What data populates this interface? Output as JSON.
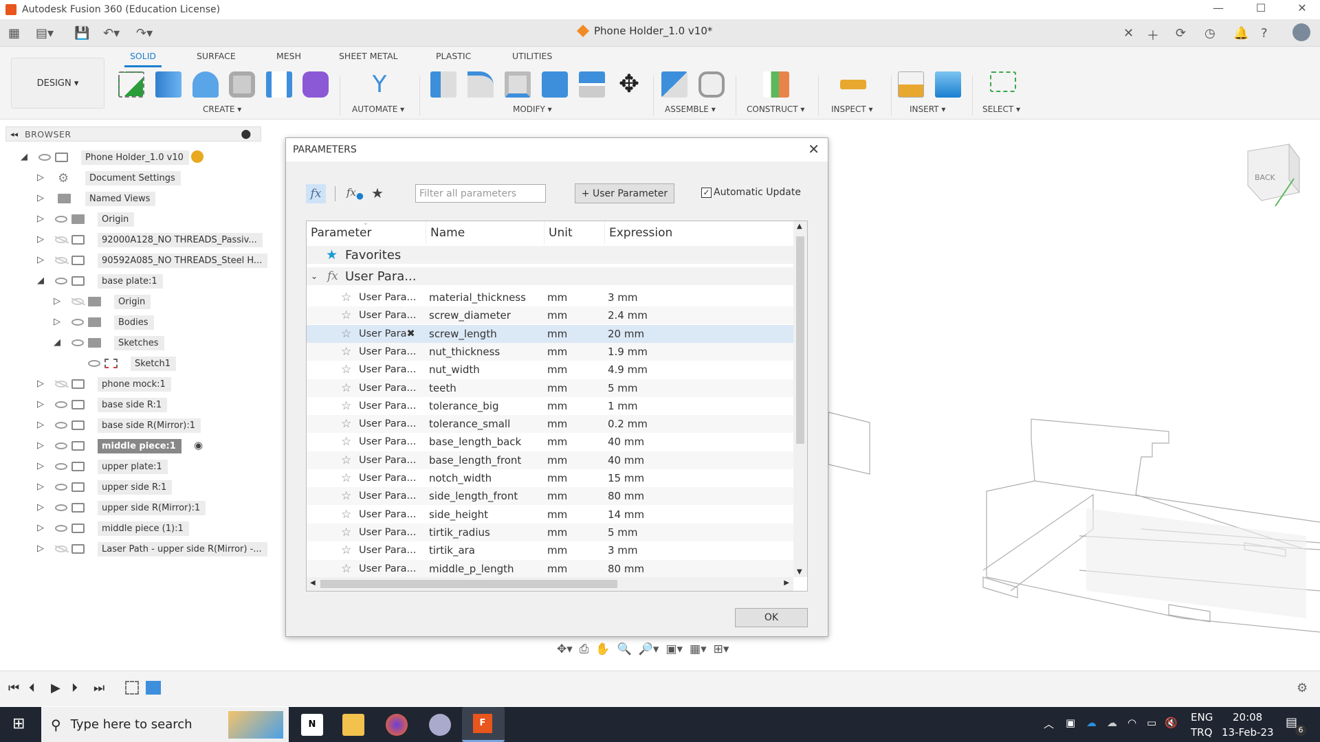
{
  "window": {
    "title": "Autodesk Fusion 360 (Education License)",
    "minimize": "—",
    "maximize": "☐",
    "close": "✕"
  },
  "document_tab": {
    "title": "Phone Holder_1.0 v10*",
    "close": "✕"
  },
  "ribbon": {
    "workspace": "DESIGN ▾",
    "tabs": [
      "SOLID",
      "SURFACE",
      "MESH",
      "SHEET METAL",
      "PLASTIC",
      "UTILITIES"
    ],
    "active_tab": "SOLID",
    "groups": [
      "CREATE ▾",
      "AUTOMATE ▾",
      "MODIFY ▾",
      "ASSEMBLE ▾",
      "CONSTRUCT ▾",
      "INSPECT ▾",
      "INSERT ▾",
      "SELECT ▾"
    ]
  },
  "browser": {
    "title": "BROWSER",
    "items": [
      {
        "label": "Phone Holder_1.0 v10",
        "level": 0,
        "expanded": true,
        "icon": "document",
        "visible": true
      },
      {
        "label": "Document Settings",
        "level": 1,
        "icon": "gear"
      },
      {
        "label": "Named Views",
        "level": 1,
        "icon": "folder"
      },
      {
        "label": "Origin",
        "level": 1,
        "icon": "folder",
        "visible": true
      },
      {
        "label": "92000A128_NO THREADS_Passiv...",
        "level": 1,
        "icon": "component",
        "visible": false
      },
      {
        "label": "90592A085_NO THREADS_Steel H...",
        "level": 1,
        "icon": "component",
        "visible": false
      },
      {
        "label": "base plate:1",
        "level": 1,
        "expanded": true,
        "icon": "component",
        "visible": true
      },
      {
        "label": "Origin",
        "level": 2,
        "icon": "folder",
        "visible": false
      },
      {
        "label": "Bodies",
        "level": 2,
        "icon": "folder",
        "visible": true
      },
      {
        "label": "Sketches",
        "level": 2,
        "expanded": true,
        "icon": "folder",
        "visible": true
      },
      {
        "label": "Sketch1",
        "level": 3,
        "icon": "sketch",
        "visible": true,
        "leaf": true
      },
      {
        "label": "phone mock:1",
        "level": 1,
        "icon": "component",
        "visible": false
      },
      {
        "label": "base side R:1",
        "level": 1,
        "icon": "component",
        "visible": true
      },
      {
        "label": "base side R(Mirror):1",
        "level": 1,
        "icon": "component",
        "visible": true
      },
      {
        "label": "middle piece:1",
        "level": 1,
        "icon": "component",
        "visible": true,
        "active": true
      },
      {
        "label": "upper plate:1",
        "level": 1,
        "icon": "component",
        "visible": true
      },
      {
        "label": "upper side R:1",
        "level": 1,
        "icon": "component",
        "visible": true
      },
      {
        "label": "upper side R(Mirror):1",
        "level": 1,
        "icon": "component",
        "visible": true
      },
      {
        "label": "middle piece (1):1",
        "level": 1,
        "icon": "component",
        "visible": true
      },
      {
        "label": "Laser Path - upper side R(Mirror) -...",
        "level": 1,
        "icon": "component",
        "visible": false
      }
    ]
  },
  "dialog": {
    "title": "PARAMETERS",
    "filter_placeholder": "Filter all parameters",
    "user_parameter_button": "+ User Parameter",
    "automatic_update": {
      "label": "Automatic Update",
      "checked": true
    },
    "columns": [
      "Parameter",
      "Name",
      "Unit",
      "Expression"
    ],
    "favorites_label": "Favorites",
    "group_label": "User Para...",
    "rows": [
      {
        "parameter": "User Para...",
        "name": "material_thickness",
        "unit": "mm",
        "expression": "3 mm"
      },
      {
        "parameter": "User Para...",
        "name": "screw_diameter",
        "unit": "mm",
        "expression": "2.4 mm"
      },
      {
        "parameter": "User Para✖",
        "name": "screw_length",
        "unit": "mm",
        "expression": "20 mm",
        "selected": true
      },
      {
        "parameter": "User Para...",
        "name": "nut_thickness",
        "unit": "mm",
        "expression": "1.9 mm"
      },
      {
        "parameter": "User Para...",
        "name": "nut_width",
        "unit": "mm",
        "expression": "4.9 mm"
      },
      {
        "parameter": "User Para...",
        "name": "teeth",
        "unit": "mm",
        "expression": "5 mm"
      },
      {
        "parameter": "User Para...",
        "name": "tolerance_big",
        "unit": "mm",
        "expression": "1 mm"
      },
      {
        "parameter": "User Para...",
        "name": "tolerance_small",
        "unit": "mm",
        "expression": "0.2 mm"
      },
      {
        "parameter": "User Para...",
        "name": "base_length_back",
        "unit": "mm",
        "expression": "40 mm"
      },
      {
        "parameter": "User Para...",
        "name": "base_length_front",
        "unit": "mm",
        "expression": "40 mm"
      },
      {
        "parameter": "User Para...",
        "name": "notch_width",
        "unit": "mm",
        "expression": "15 mm"
      },
      {
        "parameter": "User Para...",
        "name": "side_length_front",
        "unit": "mm",
        "expression": "80 mm"
      },
      {
        "parameter": "User Para...",
        "name": "side_height",
        "unit": "mm",
        "expression": "14 mm"
      },
      {
        "parameter": "User Para...",
        "name": "tirtik_radius",
        "unit": "mm",
        "expression": "5 mm"
      },
      {
        "parameter": "User Para...",
        "name": "tirtik_ara",
        "unit": "mm",
        "expression": "3 mm"
      },
      {
        "parameter": "User Para...",
        "name": "middle_p_length",
        "unit": "mm",
        "expression": "80 mm"
      }
    ],
    "ok_label": "OK"
  },
  "viewcube": {
    "face": "BACK",
    "axis": "Z"
  },
  "taskbar": {
    "search_placeholder": "Type here to search",
    "lang": "ENG",
    "layout": "TRQ",
    "time": "20:08",
    "date": "13-Feb-23",
    "notifications": "6"
  },
  "colors": {
    "accent": "#1b7fd0",
    "selected_row": "#dbe8f6",
    "taskbar": "#1f2631",
    "fusion_orange": "#e8551d"
  }
}
